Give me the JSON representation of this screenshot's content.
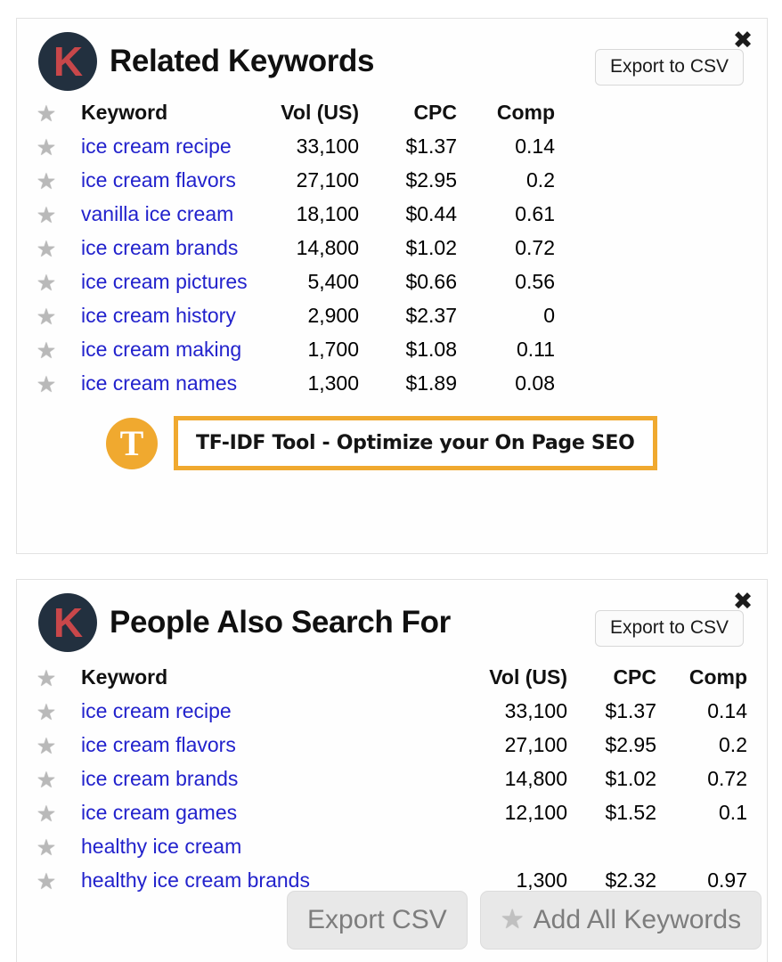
{
  "related_panel": {
    "logo_letter": "K",
    "title": "Related Keywords",
    "export_label": "Export to CSV",
    "close_icon": "✖",
    "star_icon": "★",
    "columns": {
      "keyword": "Keyword",
      "volume": "Vol (US)",
      "cpc": "CPC",
      "comp": "Comp"
    },
    "rows": [
      {
        "keyword": "ice cream recipe",
        "volume": "33,100",
        "cpc": "$1.37",
        "comp": "0.14"
      },
      {
        "keyword": "ice cream flavors",
        "volume": "27,100",
        "cpc": "$2.95",
        "comp": "0.2"
      },
      {
        "keyword": "vanilla ice cream",
        "volume": "18,100",
        "cpc": "$0.44",
        "comp": "0.61"
      },
      {
        "keyword": "ice cream brands",
        "volume": "14,800",
        "cpc": "$1.02",
        "comp": "0.72"
      },
      {
        "keyword": "ice cream pictures",
        "volume": "5,400",
        "cpc": "$0.66",
        "comp": "0.56"
      },
      {
        "keyword": "ice cream history",
        "volume": "2,900",
        "cpc": "$2.37",
        "comp": "0"
      },
      {
        "keyword": "ice cream making",
        "volume": "1,700",
        "cpc": "$1.08",
        "comp": "0.11"
      },
      {
        "keyword": "ice cream names",
        "volume": "1,300",
        "cpc": "$1.89",
        "comp": "0.08"
      }
    ],
    "promo": {
      "logo_letter": "T",
      "text": "TF-IDF Tool - Optimize your On Page SEO",
      "border_color": "#f0a92f"
    }
  },
  "pasf_panel": {
    "logo_letter": "K",
    "title": "People Also Search For",
    "export_label": "Export to CSV",
    "close_icon": "✖",
    "star_icon": "★",
    "columns": {
      "keyword": "Keyword",
      "volume": "Vol (US)",
      "cpc": "CPC",
      "comp": "Comp"
    },
    "rows": [
      {
        "keyword": "ice cream recipe",
        "volume": "33,100",
        "cpc": "$1.37",
        "comp": "0.14"
      },
      {
        "keyword": "ice cream flavors",
        "volume": "27,100",
        "cpc": "$2.95",
        "comp": "0.2"
      },
      {
        "keyword": "ice cream brands",
        "volume": "14,800",
        "cpc": "$1.02",
        "comp": "0.72"
      },
      {
        "keyword": "ice cream games",
        "volume": "12,100",
        "cpc": "$1.52",
        "comp": "0.1"
      },
      {
        "keyword": "healthy ice cream",
        "volume": "",
        "cpc": "",
        "comp": ""
      },
      {
        "keyword": "healthy ice cream brands",
        "volume": "1,300",
        "cpc": "$2.32",
        "comp": "0.97"
      }
    ]
  },
  "float_bar": {
    "export_csv_label": "Export CSV",
    "add_all_label": "Add All Keywords",
    "star_icon": "★"
  },
  "colors": {
    "logo_bg": "#22303f",
    "logo_fg": "#c8474a",
    "link": "#2222cc",
    "promo_accent": "#f0a92f",
    "panel_border": "#e2e2e2"
  }
}
